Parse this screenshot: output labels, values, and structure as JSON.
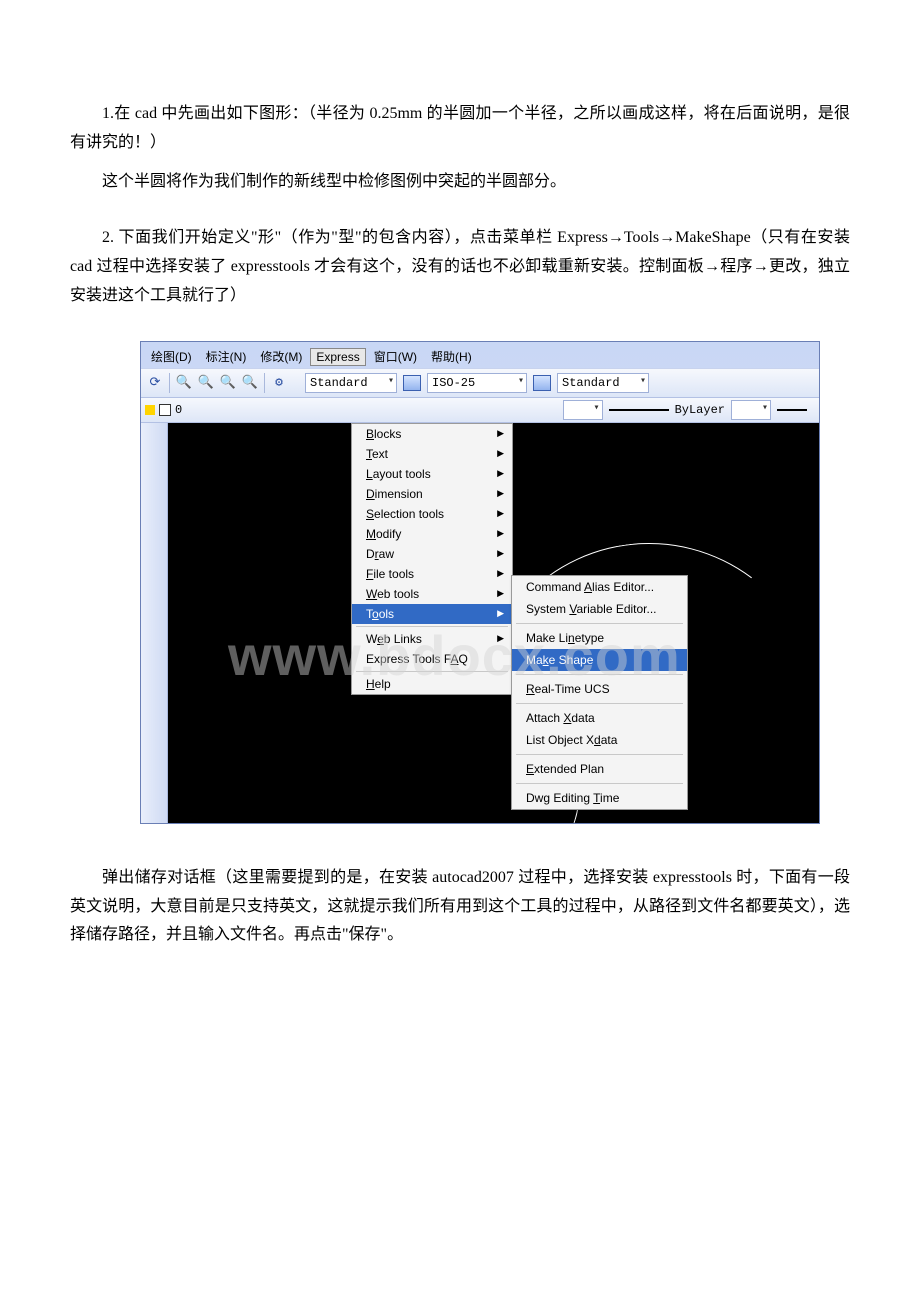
{
  "paragraphs": {
    "p1": "1.在 cad 中先画出如下图形：（半径为 0.25mm 的半圆加一个半径，之所以画成这样，将在后面说明，是很有讲究的！）",
    "p2": "这个半圆将作为我们制作的新线型中检修图例中突起的半圆部分。",
    "p3": "2. 下面我们开始定义\"形\"（作为\"型\"的包含内容），点击菜单栏 Express→Tools→MakeShape（只有在安装 cad 过程中选择安装了 expresstools 才会有这个，没有的话也不必卸载重新安装。控制面板→程序→更改，独立安装进这个工具就行了）",
    "p4": "弹出储存对话框（这里需要提到的是，在安装 autocad2007 过程中，选择安装 expresstools 时，下面有一段英文说明，大意目前是只支持英文，这就提示我们所有用到这个工具的过程中，从路径到文件名都要英文），选择储存路径，并且输入文件名。再点击\"保存\"。"
  },
  "menubar": {
    "draw": "绘图(D)",
    "dim": "标注(N)",
    "modify": "修改(M)",
    "express": "Express",
    "window": "窗口(W)",
    "help": "帮助(H)"
  },
  "toolstrip": {
    "style1": "Standard",
    "style2": "ISO-25",
    "style3": "Standard"
  },
  "layerrow": {
    "layer": "0",
    "bylayer": "ByLayer"
  },
  "express_menu": {
    "blocks": "Blocks",
    "text": "Text",
    "layout": "Layout tools",
    "dimension": "Dimension",
    "selection": "Selection tools",
    "modify": "Modify",
    "draw": "Draw",
    "file": "File tools",
    "web": "Web tools",
    "tools": "Tools",
    "weblinks": "Web Links",
    "faq": "Express Tools FAQ",
    "help": "Help"
  },
  "tools_submenu": {
    "alias": "Command Alias Editor...",
    "sysvar": "System Variable Editor...",
    "linetype": "Make Linetype",
    "shape": "Make Shape",
    "ucs": "Real-Time UCS",
    "attachx": "Attach Xdata",
    "listx": "List Object Xdata",
    "extplan": "Extended Plan",
    "dwgtime": "Dwg Editing Time"
  },
  "watermark": "www.bdocx.com"
}
